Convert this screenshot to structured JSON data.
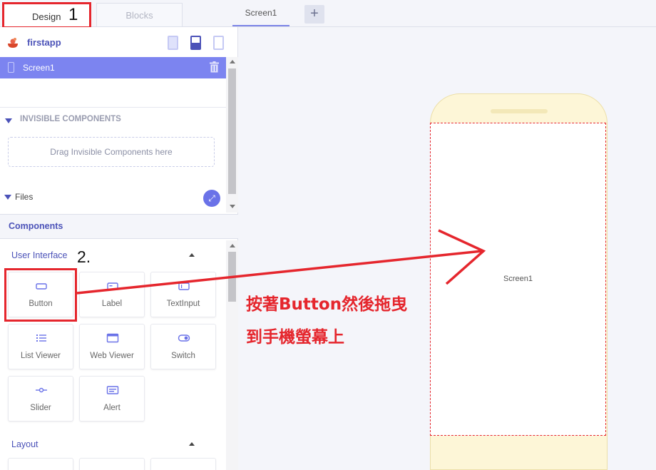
{
  "tabs": {
    "design": "Design",
    "design_marker": "1",
    "blocks": "Blocks",
    "screen": "Screen1",
    "add": "+"
  },
  "project": {
    "name": "firstapp",
    "screen_item": "Screen1"
  },
  "invisible": {
    "title": "INVISIBLE COMPONENTS",
    "drop_hint": "Drag Invisible Components here"
  },
  "files": {
    "title": "Files"
  },
  "components": {
    "header": "Components",
    "user_interface": {
      "title": "User Interface",
      "marker": "2.",
      "items": [
        {
          "label": "Button",
          "icon": "button-icon"
        },
        {
          "label": "Label",
          "icon": "label-icon"
        },
        {
          "label": "TextInput",
          "icon": "textinput-icon"
        },
        {
          "label": "List Viewer",
          "icon": "list-icon"
        },
        {
          "label": "Web Viewer",
          "icon": "web-icon"
        },
        {
          "label": "Switch",
          "icon": "switch-icon"
        },
        {
          "label": "Slider",
          "icon": "slider-icon"
        },
        {
          "label": "Alert",
          "icon": "alert-icon"
        }
      ]
    },
    "layout": {
      "title": "Layout"
    }
  },
  "canvas": {
    "screen_label": "Screen1"
  },
  "annotation": {
    "line1": "按著Button然後拖曳",
    "line2": "到手機螢幕上",
    "color": "#e5262d"
  },
  "colors": {
    "accent": "#4b52b8",
    "selected_row": "#7c84f0",
    "phone_frame": "#fdf6d7",
    "highlight": "#e5262d"
  }
}
